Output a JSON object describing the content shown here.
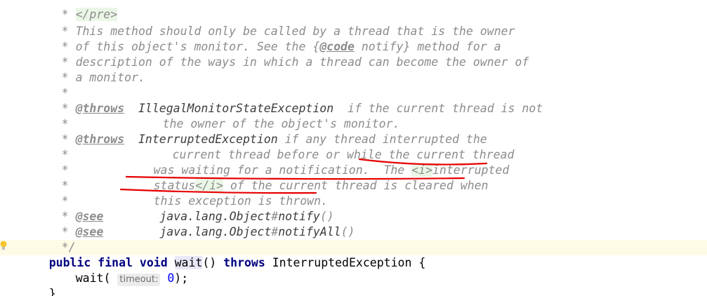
{
  "editor": {
    "comment_lines": [
      {
        "prefix": " * ",
        "pre_close": "</pre>"
      },
      {
        "prefix": " * ",
        "text": "This method should only be called by a thread that is the owner"
      },
      {
        "prefix": " * ",
        "t1": "of this object's monitor. See the {",
        "tag": "@code",
        "t2": " notify} method for a"
      },
      {
        "prefix": " * ",
        "text": "description of the ways in which a thread can become the owner of"
      },
      {
        "prefix": " * ",
        "text": "a monitor."
      },
      {
        "prefix": " *",
        "text": ""
      },
      {
        "prefix": " * ",
        "tag": "@throws",
        "param": "IllegalMonitorStateException",
        "text": " if the current thread is not"
      },
      {
        "prefix": " *",
        "text": "the owner of the object's monitor."
      },
      {
        "prefix": " * ",
        "tag": "@throws",
        "param": "InterruptedException",
        "text": " if any thread interrupted the"
      },
      {
        "prefix": " *",
        "text": "current thread before or while the current thread"
      },
      {
        "prefix": " *",
        "t1": "was waiting for a notification.  The ",
        "open_i": "<i>",
        "t2": "interrupted"
      },
      {
        "prefix": " *",
        "t1": "status",
        "close_i": "</i>",
        "t2": " of the current thread is cleared when"
      },
      {
        "prefix": " *",
        "text": "this exception is thrown."
      },
      {
        "prefix": " * ",
        "tag": "@see",
        "ref1": "java.lang.Object",
        "hash": "#",
        "ref2": "notify",
        "parens": "()"
      },
      {
        "prefix": " * ",
        "tag": "@see",
        "ref1": "java.lang.Object",
        "hash": "#",
        "ref2": "notifyAll",
        "parens": "()"
      },
      {
        "prefix": " */"
      }
    ],
    "code": {
      "sig_public": "public",
      "sig_final": "final",
      "sig_void": "void",
      "method_name": "wait",
      "sig_parens": "()",
      "sig_throws": "throws",
      "exception": "InterruptedException",
      "open_brace": "{",
      "call_name": "wait(",
      "param_hint": "timeout:",
      "arg": "0",
      "call_end": ");",
      "close_brace": "}"
    },
    "highlight_color": "#e60000"
  }
}
